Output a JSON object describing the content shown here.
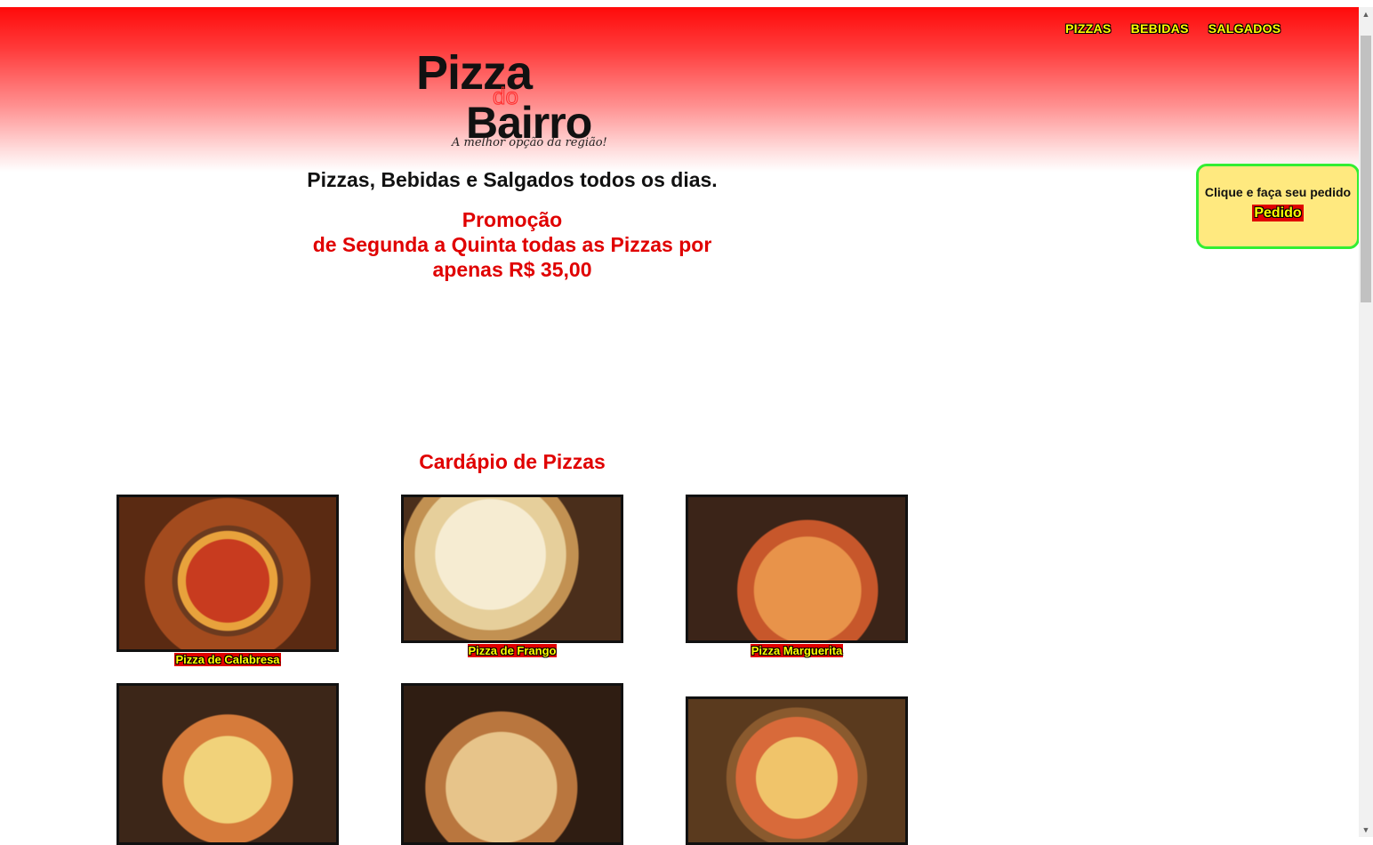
{
  "nav": {
    "items": [
      {
        "label": "PIZZAS"
      },
      {
        "label": "BEBIDAS"
      },
      {
        "label": "SALGADOS"
      }
    ]
  },
  "logo": {
    "word1": "Pizza",
    "word2": "do",
    "word3": "Bairro",
    "tagline": "A melhor opção da região!"
  },
  "hero": {
    "subtitle": "Pizzas, Bebidas e Salgados todos os dias.",
    "promo_line1": "Promoção",
    "promo_line2": "de Segunda a Quinta todas as Pizzas por",
    "promo_line3": "apenas R$ 35,00"
  },
  "order": {
    "text": "Clique e faça seu pedido",
    "button": "Pedido"
  },
  "menu": {
    "title": "Cardápio de Pizzas",
    "items": [
      {
        "label": "Pizza de Calabresa"
      },
      {
        "label": "Pizza de Frango"
      },
      {
        "label": "Pizza Marguerita"
      }
    ]
  },
  "colors": {
    "header_red": "#ff0a0a",
    "accent_red": "#e00000",
    "label_yellow": "#ffff00",
    "order_bg": "#ffe97f",
    "order_border": "#33ee33"
  }
}
